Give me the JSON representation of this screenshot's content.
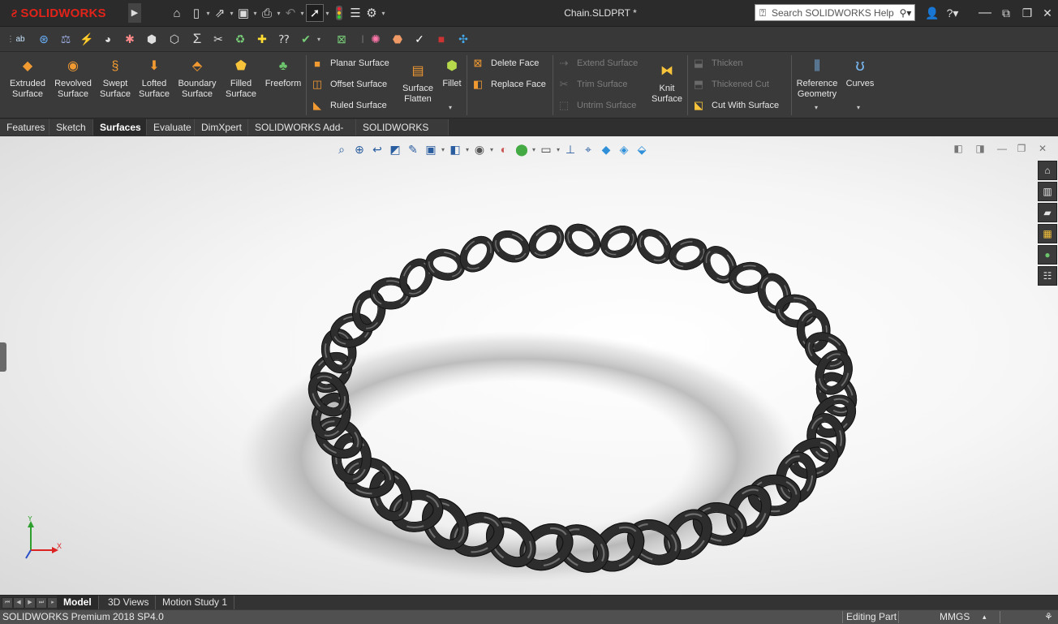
{
  "app": {
    "logo_text": "SOLIDWORKS",
    "document_title": "Chain.SLDPRT *",
    "search_placeholder": "Search SOLIDWORKS Help"
  },
  "quick_access": [
    "home-icon",
    "new-document-icon",
    "open-icon",
    "save-icon",
    "print-icon",
    "undo-icon",
    "select-icon",
    "rebuild-icon",
    "file-properties-icon",
    "options-icon"
  ],
  "ribbon": {
    "big_buttons": [
      {
        "id": "extruded-surface",
        "label_1": "Extruded",
        "label_2": "Surface"
      },
      {
        "id": "revolved-surface",
        "label_1": "Revolved",
        "label_2": "Surface"
      },
      {
        "id": "swept-surface",
        "label_1": "Swept",
        "label_2": "Surface"
      },
      {
        "id": "lofted-surface",
        "label_1": "Lofted",
        "label_2": "Surface"
      },
      {
        "id": "boundary-surface",
        "label_1": "Boundary",
        "label_2": "Surface"
      },
      {
        "id": "filled-surface",
        "label_1": "Filled",
        "label_2": "Surface"
      },
      {
        "id": "freeform",
        "label_1": "Freeform",
        "label_2": ""
      }
    ],
    "surface_group": [
      "Planar Surface",
      "Offset Surface",
      "Ruled Surface"
    ],
    "surface_flatten": {
      "label_1": "Surface",
      "label_2": "Flatten"
    },
    "fillet": "Fillet",
    "face_group": [
      "Delete Face",
      "Replace Face"
    ],
    "extend_group": [
      "Extend Surface",
      "Trim Surface",
      "Untrim Surface"
    ],
    "knit_surface": {
      "label_1": "Knit",
      "label_2": "Surface"
    },
    "thicken_group": [
      "Thicken",
      "Thickened Cut",
      "Cut With Surface"
    ],
    "reference_geometry": {
      "label_1": "Reference",
      "label_2": "Geometry"
    },
    "curves": "Curves"
  },
  "tabs": [
    "Features",
    "Sketch",
    "Surfaces",
    "Evaluate",
    "DimXpert",
    "SOLIDWORKS Add-Ins",
    "SOLIDWORKS MBD"
  ],
  "active_tab": "Surfaces",
  "triad": {
    "x": "X",
    "y": "Y"
  },
  "bottom_tabs": [
    "Model",
    "3D Views",
    "Motion Study 1"
  ],
  "status": {
    "product": "SOLIDWORKS Premium 2018 SP4.0",
    "mode": "Editing Part",
    "units": "MMGS"
  },
  "colors": {
    "brand_red": "#e2231a",
    "ribbon_bg": "#3a3a3a",
    "chain_color": "#2d2d2d"
  }
}
